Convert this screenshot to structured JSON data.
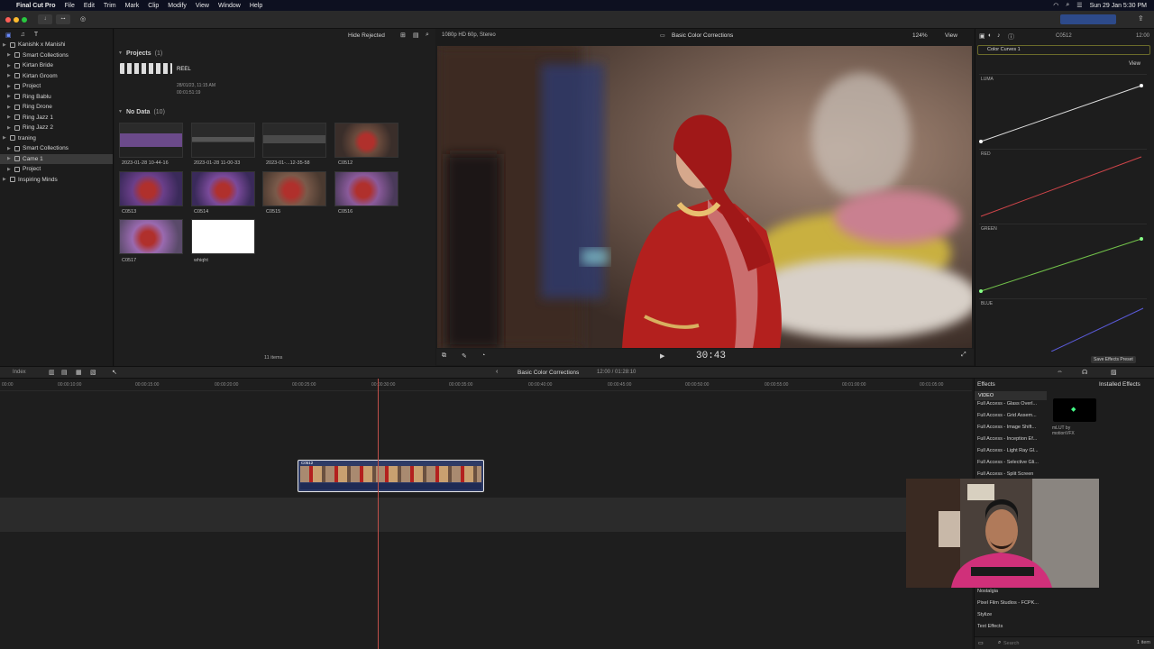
{
  "menubar": {
    "app": "Final Cut Pro",
    "items": [
      "File",
      "Edit",
      "Trim",
      "Mark",
      "Clip",
      "Modify",
      "View",
      "Window",
      "Help"
    ],
    "datetime": "Sun 29 Jan 5:30 PM"
  },
  "library": {
    "items": [
      {
        "label": "Kanishk x Manishi",
        "level": 0,
        "icon": "library-icon"
      },
      {
        "label": "Smart Collections",
        "level": 1,
        "icon": "folder-icon"
      },
      {
        "label": "Kirtan Bride",
        "level": 1,
        "icon": "event-icon"
      },
      {
        "label": "Kirtan Groom",
        "level": 1,
        "icon": "event-icon"
      },
      {
        "label": "Project",
        "level": 1,
        "icon": "event-icon"
      },
      {
        "label": "Ring Bablu",
        "level": 1,
        "icon": "event-icon"
      },
      {
        "label": "Ring Drone",
        "level": 1,
        "icon": "event-icon"
      },
      {
        "label": "Ring Jazz 1",
        "level": 1,
        "icon": "event-icon"
      },
      {
        "label": "Ring Jazz 2",
        "level": 1,
        "icon": "event-icon"
      },
      {
        "label": "traning",
        "level": 0,
        "icon": "library-icon"
      },
      {
        "label": "Smart Collections",
        "level": 1,
        "icon": "folder-icon"
      },
      {
        "label": "Came 1",
        "level": 1,
        "icon": "event-icon",
        "selected": true
      },
      {
        "label": "Project",
        "level": 1,
        "icon": "event-icon"
      },
      {
        "label": "Inspiring Minds",
        "level": 0,
        "icon": "library-icon"
      }
    ]
  },
  "browser": {
    "filter": "Hide Rejected",
    "projects_header": "Projects",
    "projects_count": "(1)",
    "project_name": "REEL",
    "project_date": "28/01/23, 11:15 AM",
    "project_duration": "00:01:51:19",
    "nodata_header": "No Data",
    "nodata_count": "(10)",
    "clips": [
      {
        "label": "2023-01-28 10-44-16"
      },
      {
        "label": "2023-01-28 11-00-33"
      },
      {
        "label": "2023-01-...12-35-58"
      },
      {
        "label": "C0512"
      },
      {
        "label": "C0513"
      },
      {
        "label": "C0514"
      },
      {
        "label": "C0515"
      },
      {
        "label": "C0516"
      },
      {
        "label": "C0517"
      },
      {
        "label": "whiqht"
      }
    ],
    "item_count": "11 items"
  },
  "viewer": {
    "format": "1080p HD 60p, Stereo",
    "title": "Basic Color Corrections",
    "zoom": "124%",
    "view_label": "View",
    "timecode": "30:43"
  },
  "inspector": {
    "clip": "C0512",
    "time": "12:00",
    "effect": "Color Curves 1",
    "view_label": "View",
    "channels": [
      "LUMA",
      "RED",
      "GREEN",
      "BLUE"
    ],
    "save_preset": "Save Effects Preset"
  },
  "timeline": {
    "index_label": "Index",
    "title": "Basic Color Corrections",
    "duration": "12:00 / 01:28:10",
    "ticks": [
      "00:00",
      "00:00:10:00",
      "00:00:15:00",
      "00:00:20:00",
      "00:00:25:00",
      "00:00:30:00",
      "00:00:35:00",
      "00:00:40:00",
      "00:00:45:00",
      "00:00:50:00",
      "00:00:55:00",
      "00:01:00:00",
      "00:01:05:00"
    ],
    "clip_label": "C0512"
  },
  "effects": {
    "header": "Effects",
    "installed": "Installed Effects",
    "category": "VIDEO",
    "items": [
      "Full Access - Glass Overl...",
      "Full Access - Grid Assem...",
      "Full Access - Image Shift...",
      "Full Access - Inception Ef...",
      "Full Access - Light Ray Gl...",
      "Full Access - Selective Gli...",
      "Full Access - Split Screen"
    ],
    "bottom_items": [
      "Nostalgia",
      "Pixel Film Studios - FCPK...",
      "Stylize",
      "Text Effects"
    ],
    "preview_label": "mLUT by motionVFX",
    "search_placeholder": "Search",
    "count": "1 item"
  }
}
